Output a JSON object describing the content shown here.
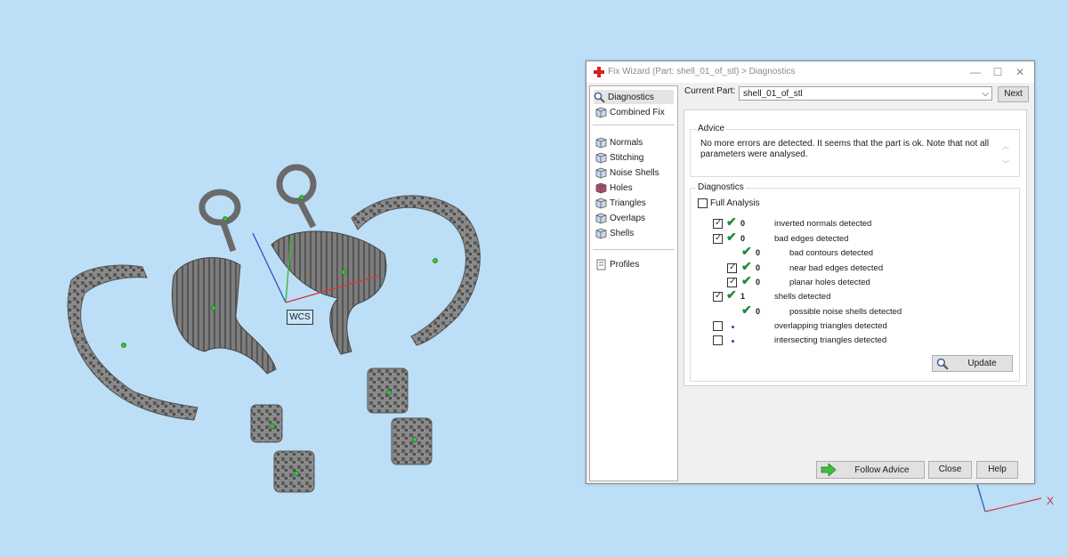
{
  "dialog": {
    "title": "Fix Wizard (Part: shell_01_of_stl) > Diagnostics",
    "minimize": "—",
    "maximize": "☐",
    "close_glyph": "✕"
  },
  "nav": {
    "items": [
      {
        "label": "Diagnostics",
        "icon": "magnifier-icon"
      },
      {
        "label": "Combined Fix",
        "icon": "cube-icon"
      },
      {
        "label": "Normals",
        "icon": "cube-icon"
      },
      {
        "label": "Stitching",
        "icon": "cube-icon"
      },
      {
        "label": "Noise Shells",
        "icon": "cube-icon"
      },
      {
        "label": "Holes",
        "icon": "cube-icon"
      },
      {
        "label": "Triangles",
        "icon": "cube-icon"
      },
      {
        "label": "Overlaps",
        "icon": "cube-icon"
      },
      {
        "label": "Shells",
        "icon": "cube-icon"
      },
      {
        "label": "Profiles",
        "icon": "document-icon"
      }
    ]
  },
  "current_part": {
    "label": "Current Part:",
    "value": "shell_01_of_stl",
    "next": "Next"
  },
  "advice": {
    "title": "Advice",
    "text": "No more errors are detected. It seems that the part is ok. Note that not all parameters were analysed."
  },
  "diagnostics": {
    "title": "Diagnostics",
    "full_analysis": "Full Analysis",
    "rows": [
      {
        "checked": true,
        "status": "ok",
        "count": "0",
        "label": "inverted normals detected"
      },
      {
        "checked": true,
        "status": "ok",
        "count": "0",
        "label": "bad edges detected"
      },
      {
        "checked": null,
        "status": "ok",
        "count": "0",
        "label": "bad contours detected"
      },
      {
        "checked": true,
        "status": "ok",
        "count": "0",
        "label": "near bad edges detected"
      },
      {
        "checked": true,
        "status": "ok",
        "count": "0",
        "label": "planar holes detected"
      },
      {
        "checked": true,
        "status": "ok",
        "count": "1",
        "label": "shells detected"
      },
      {
        "checked": null,
        "status": "ok",
        "count": "0",
        "label": "possible noise shells detected"
      },
      {
        "checked": false,
        "status": "pending",
        "count": "",
        "label": "overlapping triangles detected"
      },
      {
        "checked": false,
        "status": "pending",
        "count": "",
        "label": "intersecting triangles detected"
      }
    ],
    "update": "Update"
  },
  "footer": {
    "follow_advice": "Follow Advice",
    "close": "Close",
    "help": "Help"
  },
  "viewport": {
    "wcs_label": "WCS",
    "axis_x_label": "X"
  },
  "colors": {
    "background": "#bcdff7",
    "check_green": "#1f8a3a",
    "model_gray": "#6f6f6f"
  }
}
